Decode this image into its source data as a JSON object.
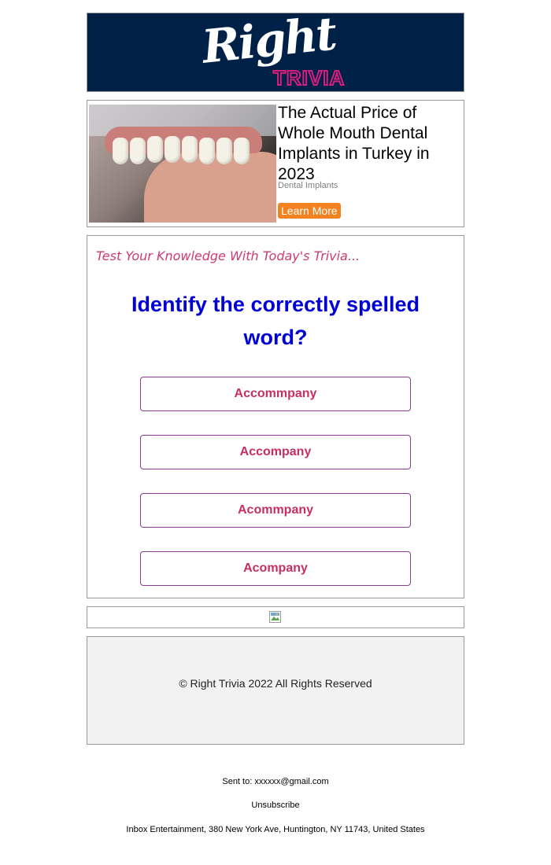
{
  "header": {
    "logo_word_1": "Right",
    "logo_word_2": "TRIVIA",
    "background_color": "#002147",
    "accent_color": "#d61f7d"
  },
  "ad": {
    "title": "The Actual Price of Whole Mouth Dental Implants in Turkey in 2023",
    "sponsor": "Dental Implants",
    "cta_label": "Learn More",
    "cta_color": "#f58220"
  },
  "trivia": {
    "intro": "Test Your Knowledge With Today's Trivia...",
    "question": "Identify the correctly spelled word?",
    "options": [
      {
        "label": "Accommpany"
      },
      {
        "label": "Accompany"
      },
      {
        "label": "Acommpany"
      },
      {
        "label": "Acompany"
      }
    ],
    "question_color": "#0000d6",
    "option_text_color": "#c72e63"
  },
  "image_block": {
    "icon": "broken-image-icon"
  },
  "footer": {
    "copyright": "© Right Trivia 2022 All Rights Reserved",
    "sent_to_label": "Sent to:",
    "sent_to_email": "xxxxxx@gmail.com",
    "unsubscribe": "Unsubscribe",
    "address": "Inbox Entertainment, 380 New York Ave, Huntington, NY 11743, United States"
  }
}
